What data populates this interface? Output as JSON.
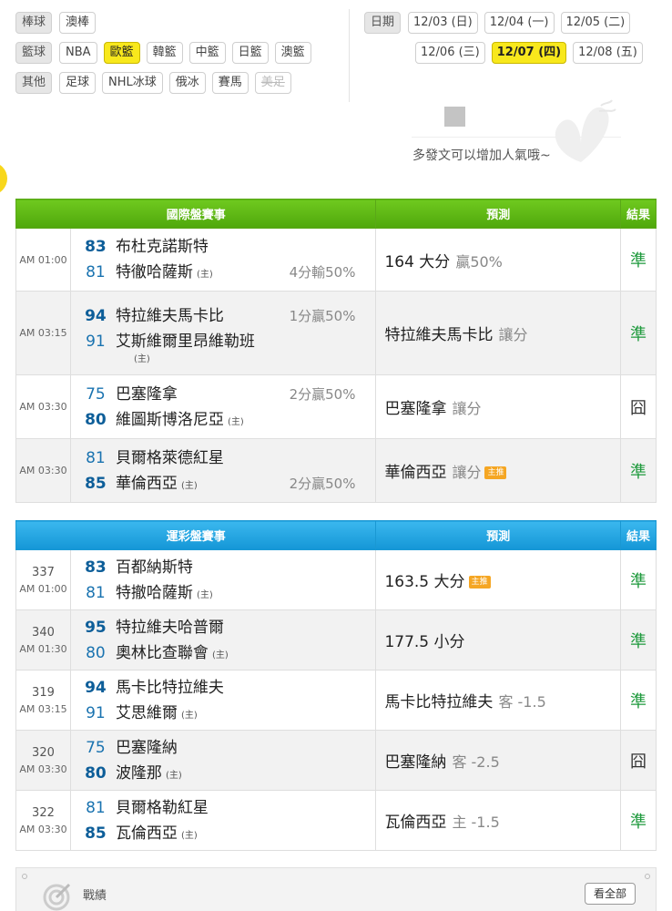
{
  "filters": {
    "rows": [
      {
        "category": "棒球",
        "items": [
          {
            "label": "澳棒",
            "state": "normal"
          }
        ]
      },
      {
        "category": "籃球",
        "items": [
          {
            "label": "NBA",
            "state": "normal"
          },
          {
            "label": "歐籃",
            "state": "active"
          },
          {
            "label": "韓籃",
            "state": "normal"
          },
          {
            "label": "中籃",
            "state": "normal"
          },
          {
            "label": "日籃",
            "state": "normal"
          },
          {
            "label": "澳籃",
            "state": "normal"
          }
        ]
      },
      {
        "category": "其他",
        "items": [
          {
            "label": "足球",
            "state": "normal"
          },
          {
            "label": "NHL冰球",
            "state": "normal"
          },
          {
            "label": "俄冰",
            "state": "normal"
          },
          {
            "label": "賽馬",
            "state": "normal"
          },
          {
            "label": "美足",
            "state": "disabled"
          }
        ]
      }
    ]
  },
  "dates": {
    "label": "日期",
    "row1": [
      {
        "label": "12/03 (日)",
        "active": false
      },
      {
        "label": "12/04 (一)",
        "active": false
      },
      {
        "label": "12/05 (二)",
        "active": false
      }
    ],
    "row2": [
      {
        "label": "12/06 (三)",
        "active": false
      },
      {
        "label": "12/07 (四)",
        "active": true
      },
      {
        "label": "12/08 (五)",
        "active": false
      }
    ]
  },
  "promo": {
    "text": "多發文可以增加人氣哦~"
  },
  "intl_table": {
    "headers": {
      "game": "國際盤賽事",
      "pred": "預測",
      "result": "結果"
    },
    "rows": [
      {
        "time": "AM 01:00",
        "team1": "布杜克諾斯特",
        "score1": "83",
        "team2": "特徹哈薩斯",
        "score2": "81",
        "home": "(主)",
        "home_pos": "t2",
        "winner": "t1",
        "handicap": "4分輸50%",
        "handi_pos": "t2",
        "pred": "164 大分",
        "pred_note": "贏50%",
        "badge": "",
        "result": "準",
        "result_ok": true
      },
      {
        "time": "AM 03:15",
        "team1": "特拉維夫馬卡比",
        "score1": "94",
        "team2": "艾斯維爾里昂維勒班",
        "score2": "91",
        "home": "(主)",
        "home_pos": "below",
        "winner": "t1",
        "handicap": "1分贏50%",
        "handi_pos": "t1",
        "pred": "特拉維夫馬卡比",
        "pred_note": "讓分",
        "badge": "",
        "result": "準",
        "result_ok": true
      },
      {
        "time": "AM 03:30",
        "team1": "巴塞隆拿",
        "score1": "75",
        "team2": "維圖斯博洛尼亞",
        "score2": "80",
        "home": "(主)",
        "home_pos": "t2",
        "winner": "t2",
        "handicap": "2分贏50%",
        "handi_pos": "t1",
        "pred": "巴塞隆拿",
        "pred_note": "讓分",
        "badge": "",
        "result": "囧",
        "result_ok": false
      },
      {
        "time": "AM 03:30",
        "team1": "貝爾格萊德紅星",
        "score1": "81",
        "team2": "華倫西亞",
        "score2": "85",
        "home": "(主)",
        "home_pos": "t2",
        "winner": "t2",
        "handicap": "2分贏50%",
        "handi_pos": "t2",
        "pred": "華倫西亞",
        "pred_note": "讓分",
        "badge": "主推",
        "result": "準",
        "result_ok": true
      }
    ]
  },
  "lottery_table": {
    "headers": {
      "game": "運彩盤賽事",
      "pred": "預測",
      "result": "結果"
    },
    "rows": [
      {
        "num": "337",
        "time": "AM 01:00",
        "team1": "百都納斯特",
        "score1": "83",
        "team2": "特撤哈薩斯",
        "score2": "81",
        "home": "(主)",
        "winner": "t1",
        "pred": "163.5 大分",
        "pred_note": "",
        "badge": "主推",
        "result": "準",
        "result_ok": true
      },
      {
        "num": "340",
        "time": "AM 01:30",
        "team1": "特拉維夫哈普爾",
        "score1": "95",
        "team2": "奧林比查聯會",
        "score2": "80",
        "home": "(主)",
        "winner": "t1",
        "pred": "177.5 小分",
        "pred_note": "",
        "badge": "",
        "result": "準",
        "result_ok": true
      },
      {
        "num": "319",
        "time": "AM 03:15",
        "team1": "馬卡比特拉維夫",
        "score1": "94",
        "team2": "艾思維爾",
        "score2": "91",
        "home": "(主)",
        "winner": "t1",
        "pred": "馬卡比特拉維夫",
        "pred_note": "客 -1.5",
        "badge": "",
        "result": "準",
        "result_ok": true
      },
      {
        "num": "320",
        "time": "AM 03:30",
        "team1": "巴塞隆納",
        "score1": "75",
        "team2": "波隆那",
        "score2": "80",
        "home": "(主)",
        "winner": "t2",
        "pred": "巴塞隆納",
        "pred_note": "客 -2.5",
        "badge": "",
        "result": "囧",
        "result_ok": false
      },
      {
        "num": "322",
        "time": "AM 03:30",
        "team1": "貝爾格勒紅星",
        "score1": "81",
        "team2": "瓦倫西亞",
        "score2": "85",
        "home": "(主)",
        "winner": "t2",
        "pred": "瓦倫西亞",
        "pred_note": "主 -1.5",
        "badge": "",
        "result": "準",
        "result_ok": true
      }
    ]
  },
  "record_bar": {
    "label": "戰績",
    "button": "看全部"
  },
  "colors": {
    "accent_yellow": "#f8e81c",
    "intl_header": "#5bb516",
    "lottery_header": "#24a7e3",
    "ok_green": "#1f9a3d"
  }
}
